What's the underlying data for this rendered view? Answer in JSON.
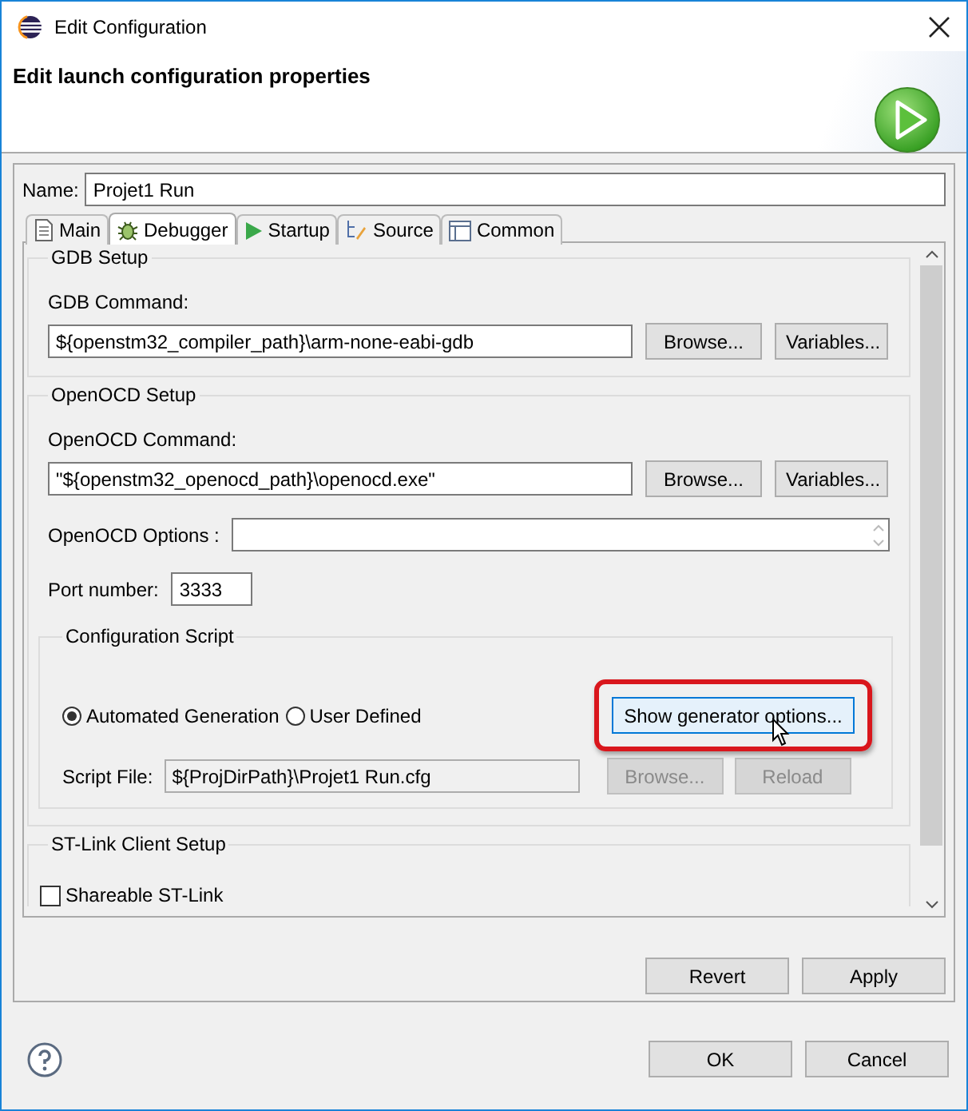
{
  "window": {
    "title": "Edit Configuration"
  },
  "header": {
    "title": "Edit launch configuration properties"
  },
  "name_field": {
    "label": "Name:",
    "value": "Projet1 Run"
  },
  "tabs": [
    {
      "label": "Main",
      "selected": false
    },
    {
      "label": "Debugger",
      "selected": true
    },
    {
      "label": "Startup",
      "selected": false
    },
    {
      "label": "Source",
      "selected": false
    },
    {
      "label": "Common",
      "selected": false
    }
  ],
  "gdb_setup": {
    "title": "GDB Setup",
    "command_label": "GDB Command:",
    "command_value": "${openstm32_compiler_path}\\arm-none-eabi-gdb",
    "buttons": [
      "Browse...",
      "Variables..."
    ]
  },
  "openocd_setup": {
    "title": "OpenOCD Setup",
    "command_label": "OpenOCD Command:",
    "command_value": "\"${openstm32_openocd_path}\\openocd.exe\"",
    "buttons": [
      "Browse...",
      "Variables..."
    ],
    "options_label": "OpenOCD Options :",
    "port_label": "Port number:",
    "port_value": "3333"
  },
  "config_script": {
    "title": "Configuration Script",
    "radios": [
      {
        "label": "Automated Generation",
        "selected": true
      },
      {
        "label": "User Defined",
        "selected": false
      }
    ],
    "generator_button": {
      "label": "Show generator options...",
      "highlighted": true
    },
    "script_file_label": "Script File:",
    "script_file_value": "${ProjDirPath}\\Projet1 Run.cfg",
    "buttons": [
      {
        "label": "Browse...",
        "disabled": true
      },
      {
        "label": "Reload",
        "disabled": true
      }
    ]
  },
  "stlink_setup": {
    "title": "ST-Link Client Setup",
    "checkbox": {
      "label": "Shareable ST-Link",
      "checked": false
    }
  },
  "panel_buttons": [
    "Revert",
    "Apply"
  ],
  "dialog_buttons": [
    "OK",
    "Cancel"
  ]
}
